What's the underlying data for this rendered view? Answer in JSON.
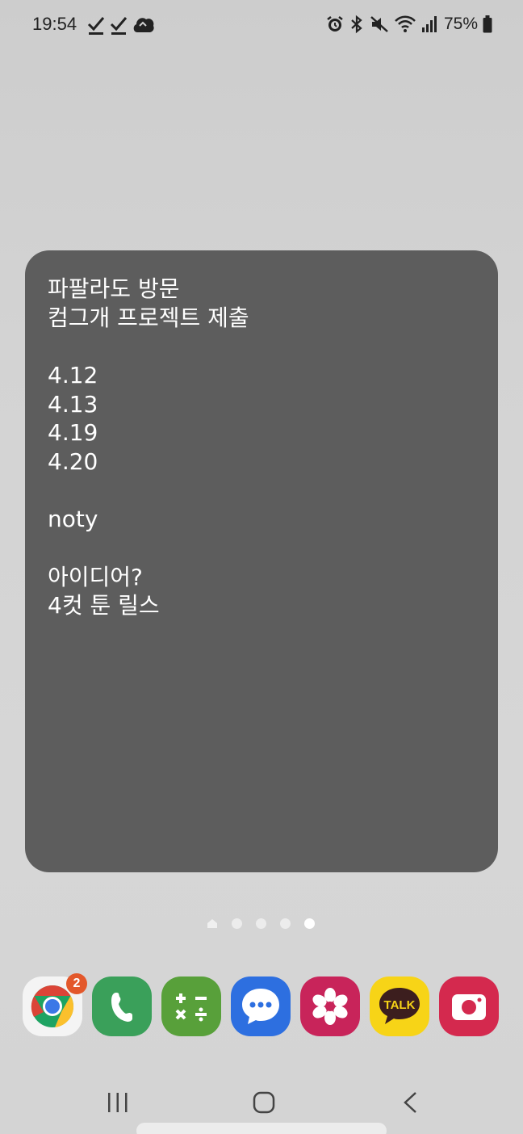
{
  "status_bar": {
    "time": "19:54",
    "left_icons": [
      "check-icon",
      "check-icon",
      "cloud-icon"
    ],
    "right_icons": [
      "alarm-icon",
      "bluetooth-icon",
      "mute-icon",
      "wifi-icon",
      "signal-icon"
    ],
    "battery_percent": "75%"
  },
  "note_widget": {
    "lines": [
      "파팔라도 방문",
      "컴그개 프로젝트 제출",
      "",
      "4.12",
      "4.13",
      "4.19",
      "4.20",
      "",
      "noty",
      "",
      "아이디어?",
      "4컷 툰 릴스"
    ],
    "background": "#5d5d5d"
  },
  "page_indicator": {
    "pages": 5,
    "current_page": 5
  },
  "dock": {
    "apps": [
      {
        "name": "Chrome",
        "badge": "2"
      },
      {
        "name": "Phone"
      },
      {
        "name": "Calculator"
      },
      {
        "name": "Messages"
      },
      {
        "name": "Gallery"
      },
      {
        "name": "KakaoTalk",
        "icon_text": "TALK"
      },
      {
        "name": "Camera"
      }
    ]
  },
  "nav_bar": {
    "buttons": [
      "recents-icon",
      "home-icon",
      "back-icon"
    ]
  }
}
